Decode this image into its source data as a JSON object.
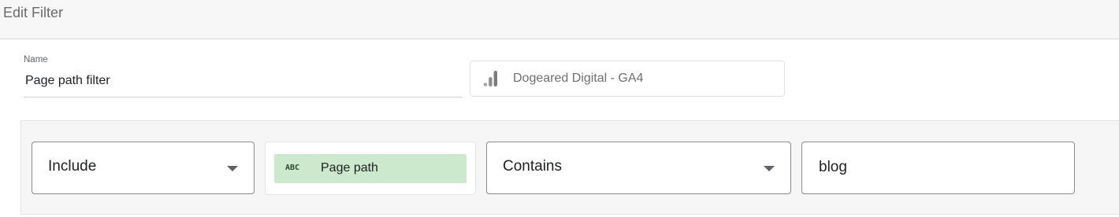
{
  "header": {
    "title": "Edit Filter"
  },
  "name_field": {
    "label": "Name",
    "value": "Page path filter"
  },
  "data_source": {
    "icon": "analytics-bars-icon",
    "name": "Dogeared Digital - GA4"
  },
  "clause": {
    "include_exclude": "Include",
    "dimension": {
      "type_icon_text": "ABC",
      "label": "Page path",
      "chip_color": "#cce8cd"
    },
    "condition": "Contains",
    "value": "blog"
  },
  "colors": {
    "header_bg": "#f7f7f7",
    "panel_bg": "#f6f6f6",
    "ga_orange_dark": "#8a8a8a"
  }
}
